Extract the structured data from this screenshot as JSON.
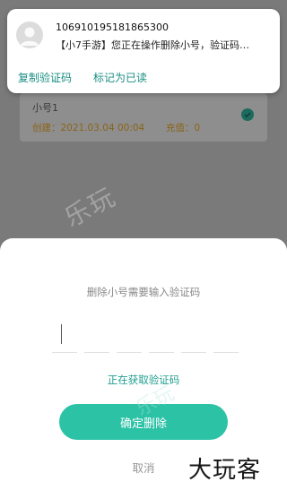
{
  "notification": {
    "sender": "106910195181865300",
    "message": "【小7手游】您正在操作删除小号，验证码…",
    "actions": [
      "复制验证码",
      "标记为已读"
    ]
  },
  "account_card": {
    "name": "小号1",
    "created": "创建：2021.03.04 00:04",
    "recharge": "充值：0"
  },
  "sheet": {
    "title": "删除小号需要输入验证码",
    "code_value": "",
    "status": "正在获取验证码",
    "confirm_label": "确定删除",
    "cancel_label": "取消"
  },
  "watermark": {
    "text": "乐玩",
    "text2": "乐玩"
  },
  "brand": {
    "text": "大玩客"
  },
  "colors": {
    "accent": "#2cc2a6",
    "link": "#1a8f84",
    "overlay": "#7a7a7a",
    "created_text": "#8a6418"
  }
}
